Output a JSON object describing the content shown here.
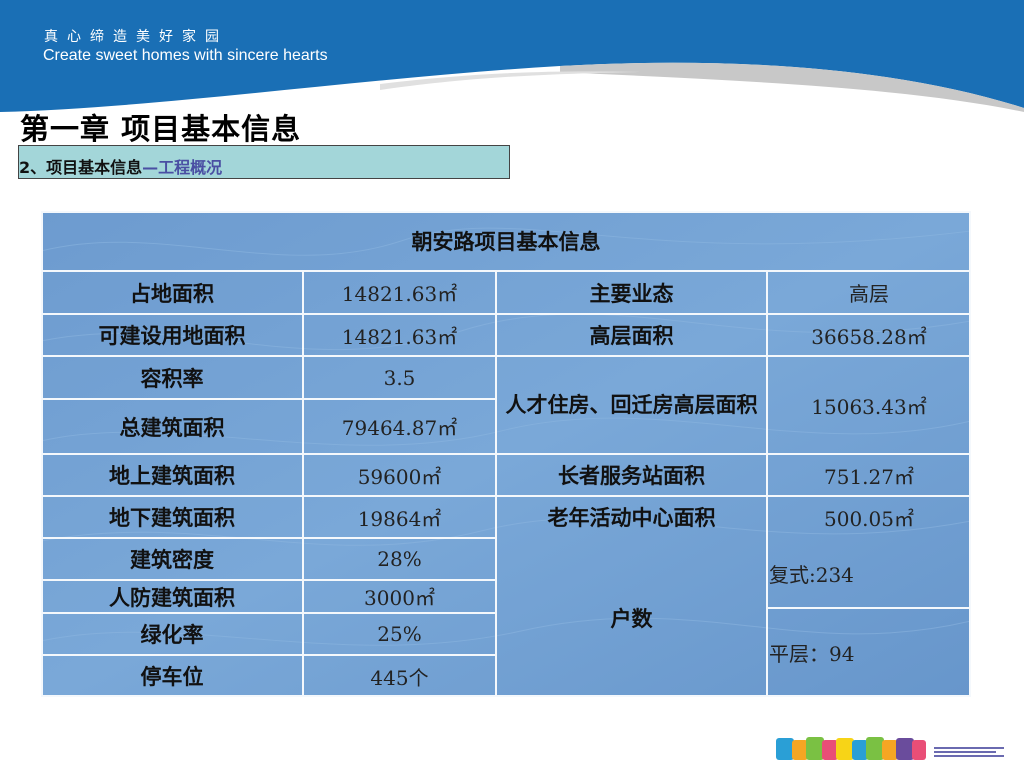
{
  "header": {
    "slogan_cn": "真心缔造美好家园",
    "slogan_en": "Create sweet homes with sincere hearts",
    "brand_blue": "#1a6fb5"
  },
  "chapter_title": "第一章 项目基本信息",
  "section": {
    "main": "2、项目基本信息",
    "sub": "—工程概况",
    "bg_color": "#a3d6d9"
  },
  "table": {
    "title": "朝安路项目基本信息",
    "cell_color": "#6f9ed0",
    "rows_left": [
      {
        "label": "占地面积",
        "value": "14821.63㎡"
      },
      {
        "label": "可建设用地面积",
        "value": "14821.63㎡"
      },
      {
        "label": "容积率",
        "value": "3.5"
      },
      {
        "label": "总建筑面积",
        "value": "79464.87㎡"
      },
      {
        "label": "地上建筑面积",
        "value": "59600㎡"
      },
      {
        "label": "地下建筑面积",
        "value": "19864㎡"
      },
      {
        "label": "建筑密度",
        "value": "28%"
      },
      {
        "label": "人防建筑面积",
        "value": "3000㎡"
      },
      {
        "label": "绿化率",
        "value": "25%"
      },
      {
        "label": "停车位",
        "value": "445个"
      }
    ],
    "rows_right": [
      {
        "label": "主要业态",
        "value": "高层"
      },
      {
        "label": "高层面积",
        "value": "36658.28㎡"
      },
      {
        "label": "人才住房、回迁房高层面积",
        "value": "15063.43㎡"
      },
      {
        "label": "长者服务站面积",
        "value": "751.27㎡"
      },
      {
        "label": "老年活动中心面积",
        "value": "500.05㎡"
      }
    ],
    "households": {
      "label": "户数",
      "duplex": "复式:234",
      "flat": "平层：94"
    }
  },
  "footer_logo": {
    "colors": [
      "#2a9fd6",
      "#f5a623",
      "#7ac143",
      "#e94e77",
      "#f7d417",
      "#6a4c9c"
    ]
  }
}
